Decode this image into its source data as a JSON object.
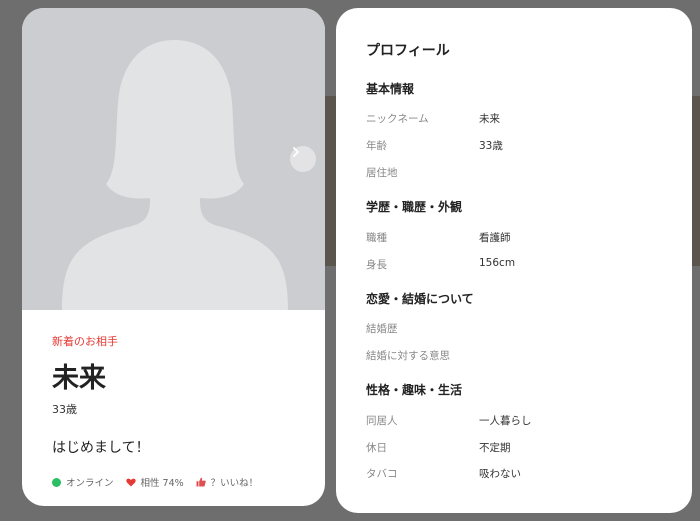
{
  "card": {
    "new_label": "新着のお相手",
    "name": "未来",
    "age": "33歳",
    "greeting": "はじめまして！",
    "status": {
      "online": "オンライン",
      "compatibility": "相性 74%",
      "likes": "？いいね！"
    }
  },
  "profile": {
    "title": "プロフィール",
    "sections": [
      {
        "title": "基本情報",
        "rows": [
          {
            "label": "ニックネーム",
            "value": "未来"
          },
          {
            "label": "年齢",
            "value": "33歳"
          },
          {
            "label": "居住地",
            "value": ""
          }
        ]
      },
      {
        "title": "学歴・職歴・外観",
        "rows": [
          {
            "label": "職種",
            "value": "看護師"
          },
          {
            "label": "身長",
            "value": "156cm"
          }
        ]
      },
      {
        "title": "恋愛・結婚について",
        "rows": [
          {
            "label": "結婚歴",
            "value": ""
          },
          {
            "label": "結婚に対する意思",
            "value": ""
          }
        ]
      },
      {
        "title": "性格・趣味・生活",
        "rows": [
          {
            "label": "同居人",
            "value": "一人暮らし"
          },
          {
            "label": "休日",
            "value": "不定期"
          },
          {
            "label": "タバコ",
            "value": "吸わない"
          }
        ]
      }
    ]
  },
  "colors": {
    "accent_red": "#e53935",
    "online_green": "#2bbf63",
    "heart_red": "#e53935",
    "thumb_red": "#e05050"
  }
}
